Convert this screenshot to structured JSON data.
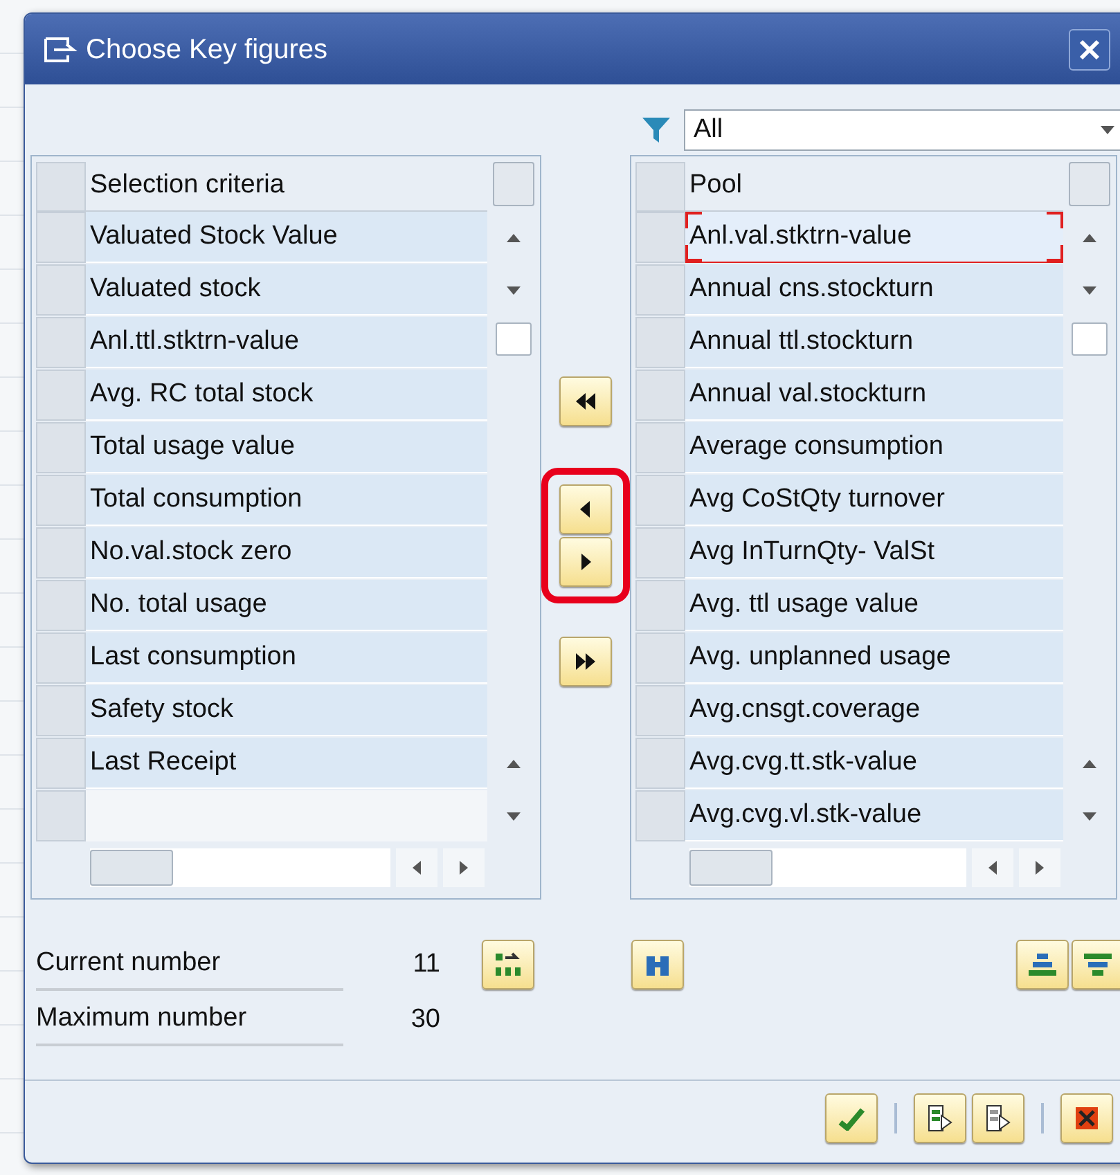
{
  "window": {
    "title": "Choose Key figures"
  },
  "filter": {
    "value": "All"
  },
  "selection_table": {
    "header": "Selection criteria",
    "rows": [
      {
        "label": "Valuated Stock Value",
        "selected": false
      },
      {
        "label": "Valuated stock",
        "selected": false
      },
      {
        "label": "Anl.ttl.stktrn-value",
        "selected": false
      },
      {
        "label": "Avg. RC total stock",
        "selected": false
      },
      {
        "label": "Total usage value",
        "selected": false
      },
      {
        "label": "Total consumption",
        "selected": false
      },
      {
        "label": "No.val.stock zero",
        "selected": false
      },
      {
        "label": "No. total usage",
        "selected": false
      },
      {
        "label": "Last consumption",
        "selected": false
      },
      {
        "label": "Safety stock",
        "selected": false
      },
      {
        "label": "Last Receipt",
        "selected": false
      }
    ]
  },
  "pool_table": {
    "header": "Pool",
    "rows": [
      {
        "label": "Anl.val.stktrn-value",
        "selected": true
      },
      {
        "label": "Annual cns.stockturn",
        "selected": false
      },
      {
        "label": "Annual ttl.stockturn",
        "selected": false
      },
      {
        "label": "Annual val.stockturn",
        "selected": false
      },
      {
        "label": "Average consumption",
        "selected": false
      },
      {
        "label": "Avg CoStQty turnover",
        "selected": false
      },
      {
        "label": "Avg InTurnQty- ValSt",
        "selected": false
      },
      {
        "label": "Avg. ttl usage value",
        "selected": false
      },
      {
        "label": "Avg. unplanned usage",
        "selected": false
      },
      {
        "label": "Avg.cnsgt.coverage",
        "selected": false
      },
      {
        "label": "Avg.cvg.tt.stk-value",
        "selected": false
      },
      {
        "label": "Avg.cvg.vl.stk-value",
        "selected": false
      }
    ]
  },
  "counts": [
    {
      "label": "Current number",
      "value": "11"
    },
    {
      "label": "Maximum number",
      "value": "30"
    }
  ]
}
